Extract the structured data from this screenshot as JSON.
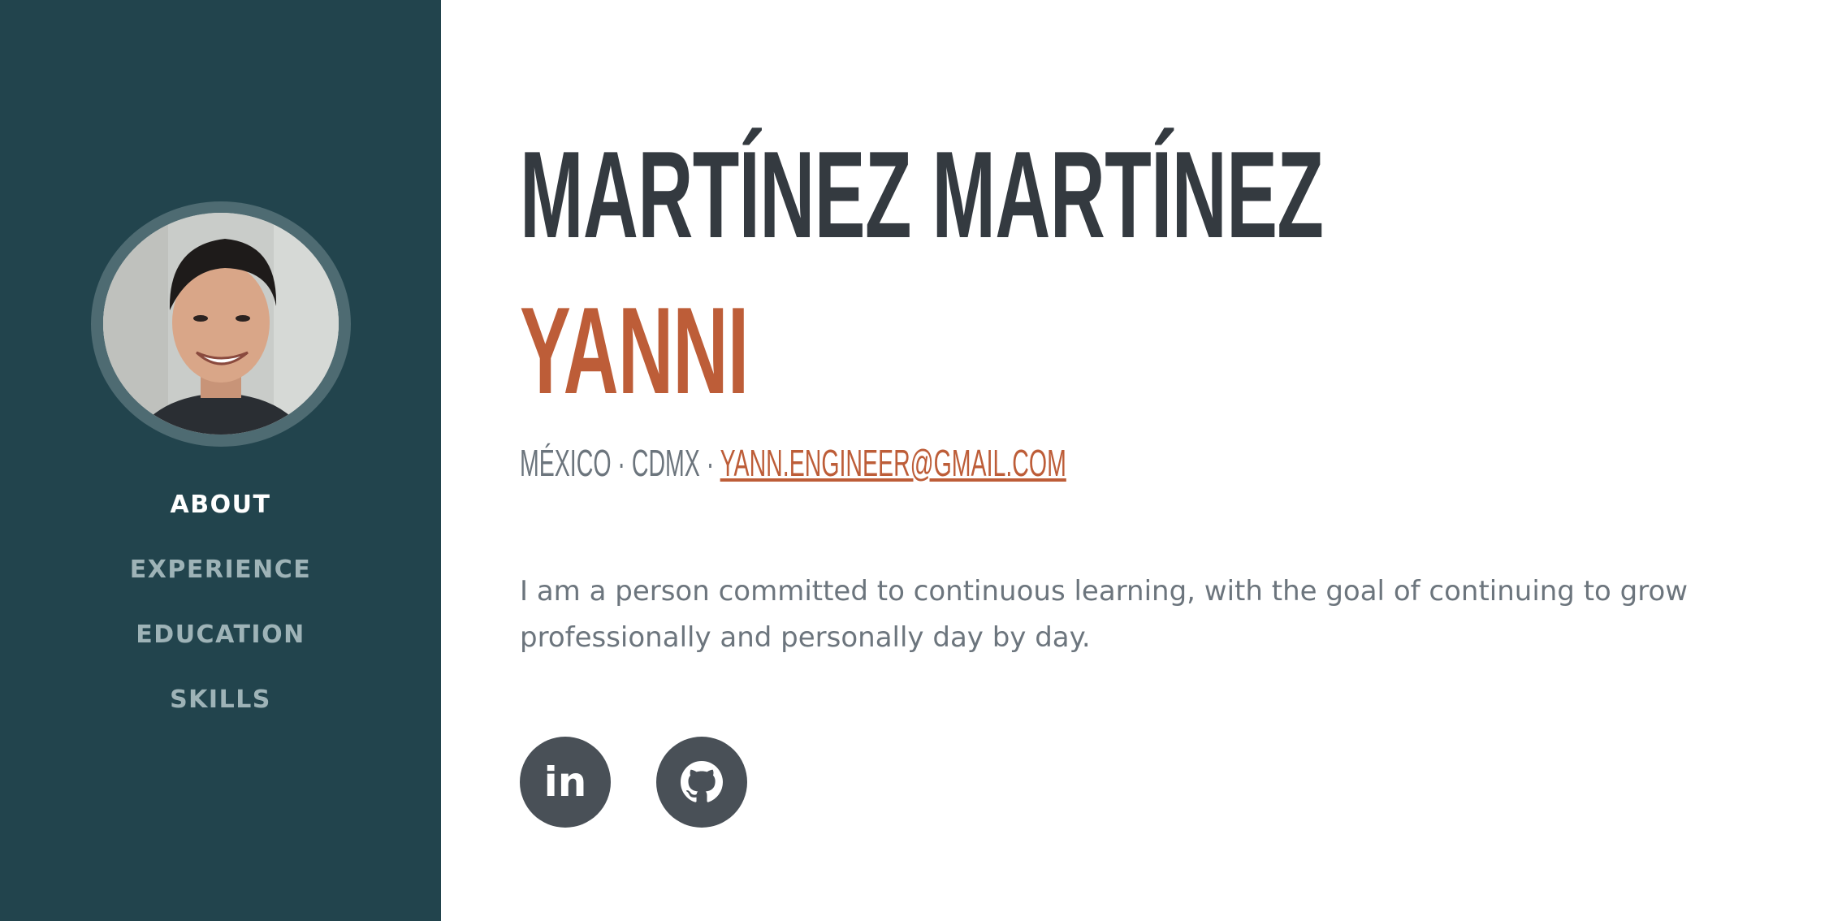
{
  "sidebar": {
    "avatar_alt": "profile photo",
    "nav": [
      {
        "label": "ABOUT",
        "active": true
      },
      {
        "label": "EXPERIENCE",
        "active": false
      },
      {
        "label": "EDUCATION",
        "active": false
      },
      {
        "label": "SKILLS",
        "active": false
      }
    ]
  },
  "about": {
    "last_name": "MARTÍNEZ MARTÍNEZ",
    "first_name": "YANNI",
    "location": "MÉXICO · CDMX · ",
    "email": "YANN.ENGINEER@GMAIL.COM",
    "bio": "I am a person committed to continuous learning, with the goal of continuing to grow professionally and personally day by day."
  },
  "social": {
    "linkedin_glyph": "in",
    "github_icon": "github-icon"
  },
  "colors": {
    "sidebar_bg": "#22444d",
    "accent": "#bd5d38",
    "heading": "#343a40",
    "muted_text": "#6c757d",
    "nav_inactive": "#9eb3b7",
    "social_bg": "#495057"
  }
}
